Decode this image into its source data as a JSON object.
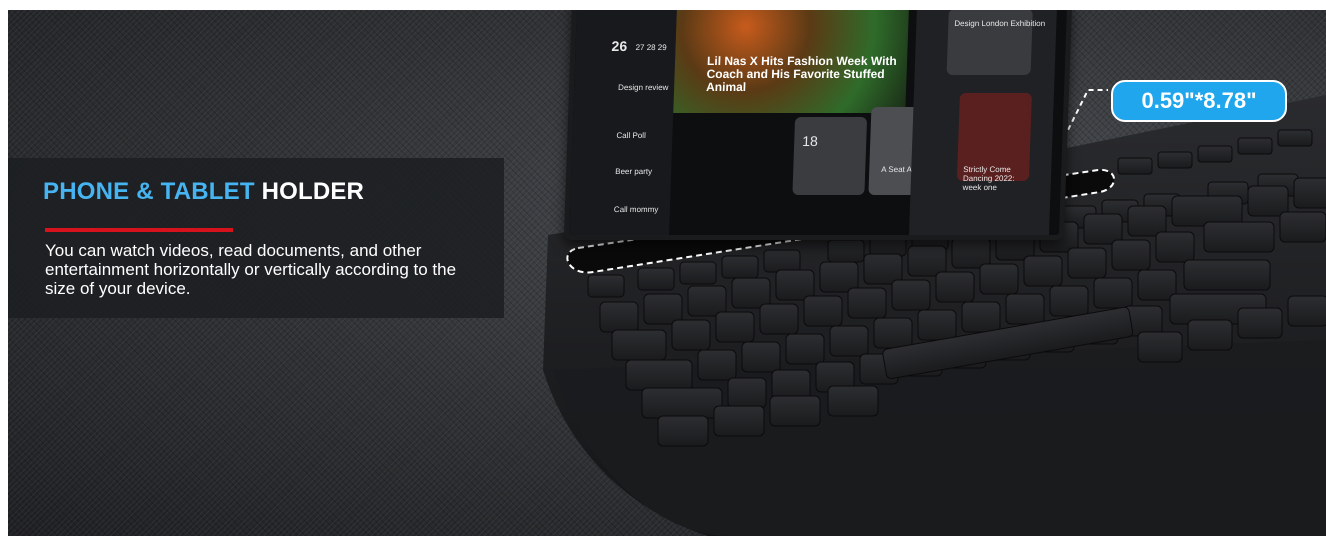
{
  "headline": {
    "accent": "PHONE & TABLET",
    "main": "HOLDER"
  },
  "description": "You can watch videos, read documents, and other entertainment horizontally or vertically according to the size of your device.",
  "dimension_label": "0.59\"*8.78\"",
  "tablet_screen": {
    "calendar_day": "26",
    "calendar_days": "27 28 29",
    "events": [
      "Design review",
      "Call Poll",
      "Beer party",
      "Call mommy"
    ],
    "headline": "Lil Nas X Hits Fashion Week With Coach and His Favorite Stuffed Animal",
    "stock_value": "18",
    "track_title": "A Seat At The Table",
    "card_title": "Strictly Come Dancing 2022: week one",
    "top_card_title": "Design London Exhibition"
  },
  "colors": {
    "accent_blue": "#46b4f0",
    "accent_red": "#d6121d",
    "callout_blue": "#1fa6ec"
  }
}
